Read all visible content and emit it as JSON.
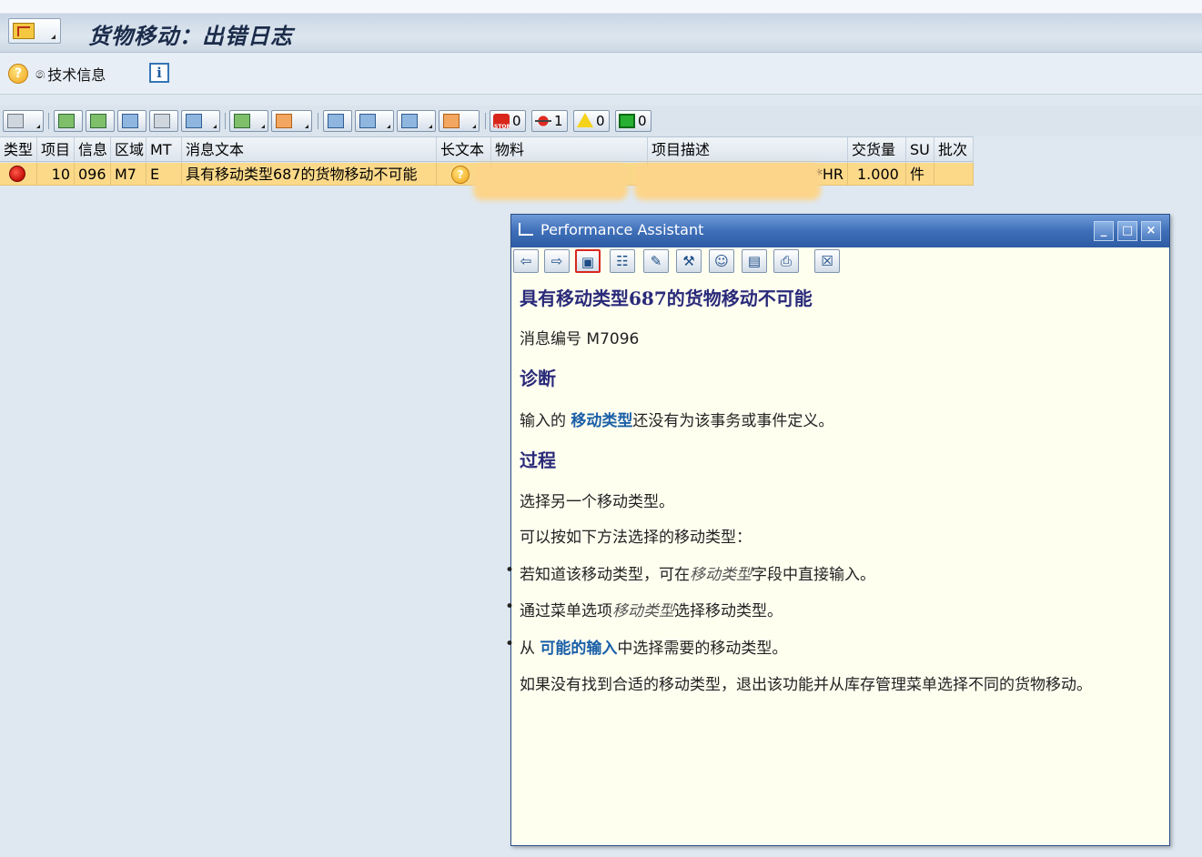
{
  "header": {
    "title": "货物移动：出错日志"
  },
  "app_toolbar": {
    "tech_info_label": "技术信息",
    "info_label": "i"
  },
  "alv_toolbar": {
    "stop_count": "0",
    "error_count": "1",
    "warning_count": "0",
    "success_count": "0"
  },
  "grid": {
    "columns": [
      "类型",
      "项目",
      "信息",
      "区域",
      "MT",
      "消息文本",
      "长文本",
      "物料",
      "项目描述",
      "交货量",
      "SU",
      "批次"
    ],
    "rows": [
      {
        "item": "10",
        "msg_no": "096",
        "area": "M7",
        "mt": "E",
        "text": "具有移动类型687的货物移动不可能",
        "desc_suffix": "*HR",
        "qty": "1.000",
        "su": "件",
        "batch": ""
      }
    ]
  },
  "pa": {
    "window_title": "Performance Assistant",
    "title": "具有移动类型687的货物移动不可能",
    "msg_number": "消息编号 M7096",
    "diagnosis_heading": "诊断",
    "diagnosis_pre": "输入的 ",
    "diagnosis_link": "移动类型",
    "diagnosis_post": "还没有为该事务或事件定义。",
    "procedure_heading": "过程",
    "proc_line1": "选择另一个移动类型。",
    "proc_line2": "可以按如下方法选择的移动类型：",
    "bullet1_pre": "若知道该移动类型，可在",
    "bullet1_it": "移动类型",
    "bullet1_post": "字段中直接输入。",
    "bullet2_pre": "通过菜单选项",
    "bullet2_it": "移动类型",
    "bullet2_post": "选择移动类型。",
    "bullet3_pre": "从 ",
    "bullet3_link": "可能的输入",
    "bullet3_post": "中选择需要的移动类型。",
    "final_line": "如果没有找到合适的移动类型，退出该功能并从库存管理菜单选择不同的货物移动。"
  }
}
